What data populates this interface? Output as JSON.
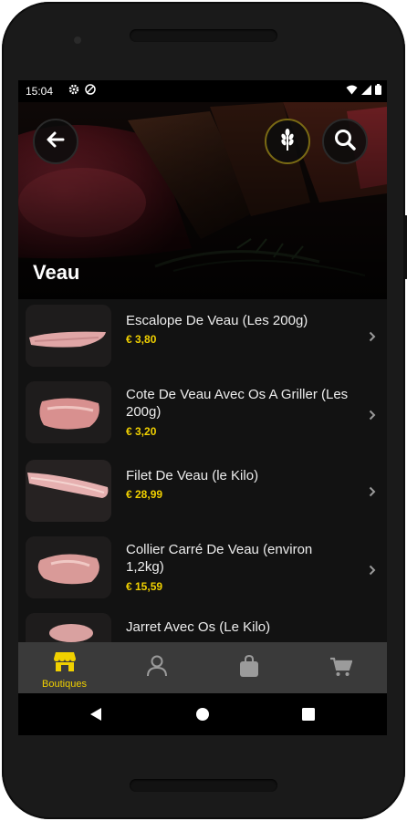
{
  "status_bar": {
    "time": "15:04"
  },
  "header": {
    "title": "Veau"
  },
  "products": [
    {
      "name": "Escalope De Veau (Les 200g)",
      "price": "€ 3,80"
    },
    {
      "name": "Cote De Veau Avec Os A Griller (Les 200g)",
      "price": "€ 3,20"
    },
    {
      "name": "Filet De Veau (le Kilo)",
      "price": "€ 28,99"
    },
    {
      "name": "Collier Carré De Veau (environ 1,2kg)",
      "price": "€ 15,59"
    },
    {
      "name": "Jarret Avec Os (Le Kilo)",
      "price": ""
    }
  ],
  "bottom_nav": {
    "items": [
      {
        "label": "Boutiques",
        "icon": "shop-icon",
        "active": true
      },
      {
        "label": "",
        "icon": "user-icon",
        "active": false
      },
      {
        "label": "",
        "icon": "bag-icon",
        "active": false
      },
      {
        "label": "",
        "icon": "cart-icon",
        "active": false
      }
    ]
  },
  "colors": {
    "accent": "#f0d000",
    "background": "#121212",
    "nav_background": "#3a3a3a"
  }
}
